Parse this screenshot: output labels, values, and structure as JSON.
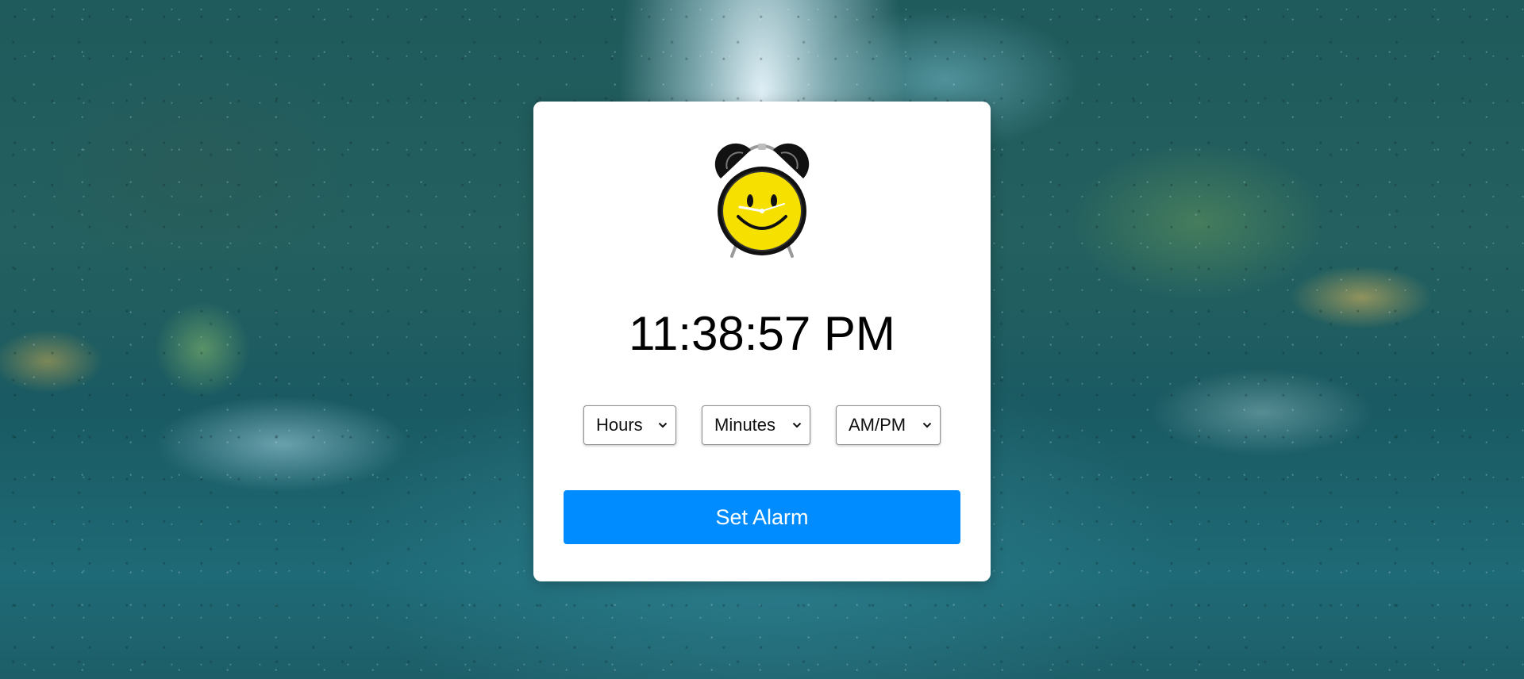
{
  "clock": {
    "current_time": "11:38:57 PM",
    "icon": "smiley-alarm-clock-icon"
  },
  "alarm": {
    "hours_label": "Hours",
    "minutes_label": "Minutes",
    "ampm_label": "AM/PM",
    "set_button_label": "Set Alarm"
  },
  "colors": {
    "button": "#008cff",
    "card": "#ffffff",
    "clock_face": "#f5e000"
  }
}
